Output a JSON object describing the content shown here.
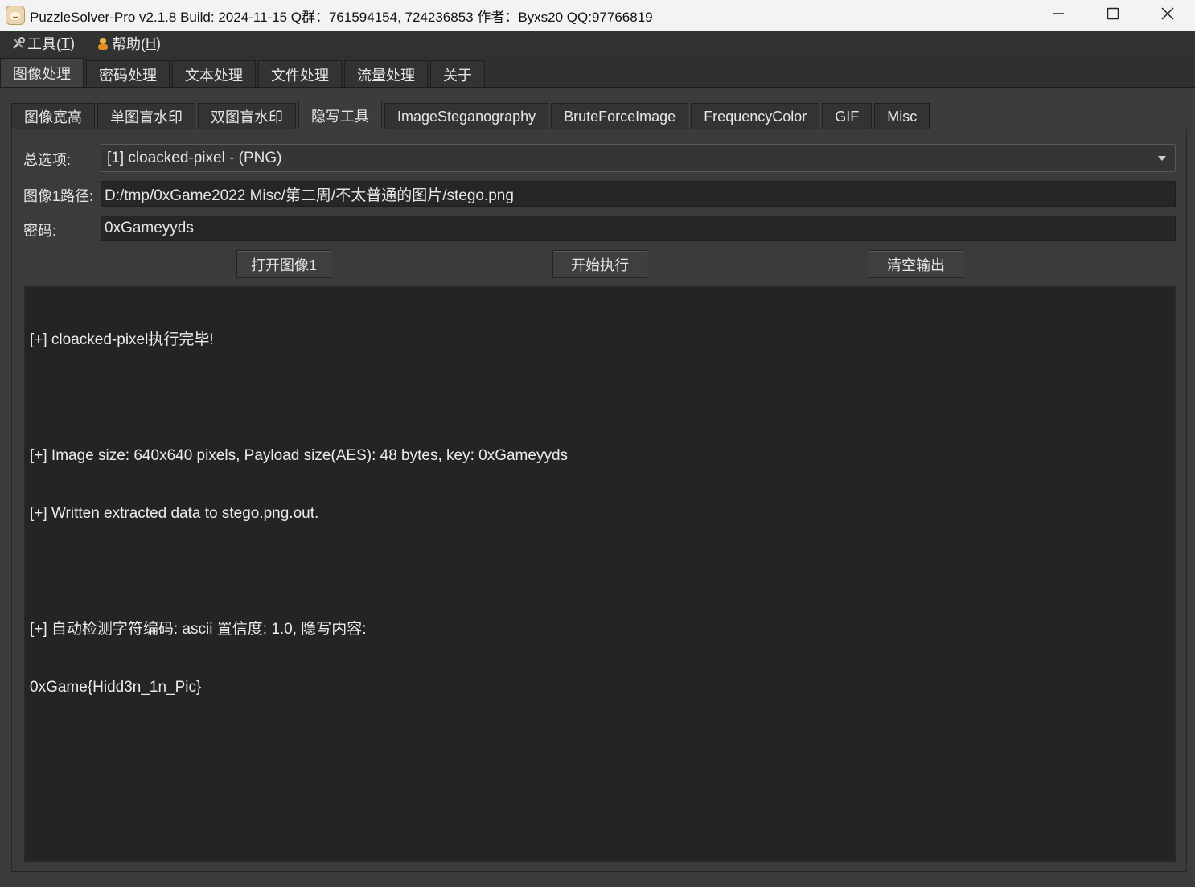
{
  "window": {
    "title": "PuzzleSolver-Pro v2.1.8  Build: 2024-11-15  Q群：761594154, 724236853  作者：Byxs20  QQ:97766819",
    "icons": {
      "app": "alpaca-icon",
      "minimize": "minimize-icon",
      "maximize": "maximize-icon",
      "close": "close-icon"
    }
  },
  "menubar": {
    "items": [
      {
        "label_prefix": "工具(",
        "mnemonic": "T",
        "label_suffix": ")",
        "icon": "tools-icon"
      },
      {
        "label_prefix": "帮助(",
        "mnemonic": "H",
        "label_suffix": ")",
        "icon": "help-person-icon"
      }
    ]
  },
  "main_tabs": [
    "图像处理",
    "密码处理",
    "文本处理",
    "文件处理",
    "流量处理",
    "关于"
  ],
  "sub_tabs": [
    "图像宽高",
    "单图盲水印",
    "双图盲水印",
    "隐写工具",
    "ImageSteganography",
    "BruteForceImage",
    "FrequencyColor",
    "GIF",
    "Misc"
  ],
  "form": {
    "option_label": "总选项:",
    "option_value": "[1] cloacked-pixel - (PNG)",
    "path_label": "图像1路径:",
    "path_value": "D:/tmp/0xGame2022 Misc/第二周/不太普通的图片/stego.png",
    "password_label": "密码:",
    "password_value": "0xGameyyds"
  },
  "buttons": {
    "open": "打开图像1",
    "run": "开始执行",
    "clear": "清空输出"
  },
  "output": {
    "lines": [
      "[+] cloacked-pixel执行完毕!",
      "",
      "[+] Image size: 640x640 pixels, Payload size(AES): 48 bytes, key: 0xGameyyds",
      "[+] Written extracted data to stego.png.out.",
      "",
      "[+] 自动检测字符编码: ascii 置信度: 1.0, 隐写内容:",
      "0xGame{Hidd3n_1n_Pic}"
    ]
  }
}
